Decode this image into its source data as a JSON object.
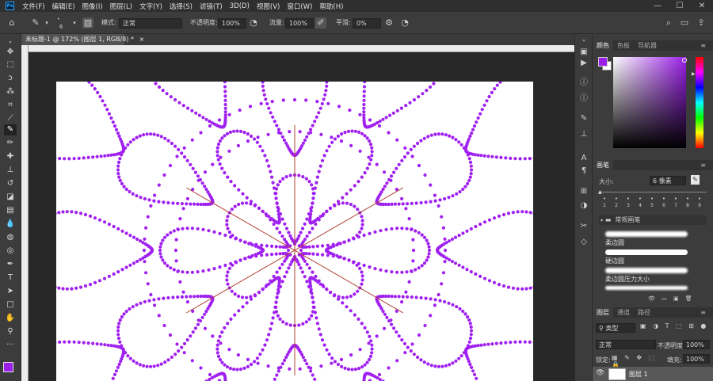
{
  "app": {
    "logo_text": "Ps"
  },
  "menu": [
    "文件(F)",
    "编辑(E)",
    "图像(I)",
    "图层(L)",
    "文字(Y)",
    "选择(S)",
    "滤镜(T)",
    "3D(D)",
    "视图(V)",
    "窗口(W)",
    "帮助(H)"
  ],
  "window_controls": {
    "minimize": "—",
    "maximize": "☐",
    "close": "✕"
  },
  "options": {
    "brush_size": "6",
    "mode_label": "模式:",
    "mode_value": "正常",
    "opacity_label": "不透明度:",
    "opacity_value": "100%",
    "flow_label": "流量:",
    "flow_value": "100%",
    "smooth_label": "平滑:",
    "smooth_value": "0%"
  },
  "document_tab": {
    "title": "未标题-1 @ 172% (图层 1, RGB/8) *",
    "close": "×"
  },
  "color_panel": {
    "tabs": [
      "颜色",
      "色板",
      "导航器"
    ],
    "foreground": "#9b1fe8",
    "background": "#ffffff"
  },
  "brush_panel": {
    "title": "画笔",
    "size_label": "大小:",
    "size_value": "6 像素",
    "presets_cells": [
      "1",
      "2",
      "3",
      "4",
      "5",
      "6",
      "7",
      "8",
      "9"
    ],
    "folder_label": "常规画笔",
    "brushes": [
      "柔边圆",
      "硬边圆",
      "柔边圆压力大小",
      ""
    ]
  },
  "layers_panel": {
    "tabs": [
      "图层",
      "通道",
      "路径"
    ],
    "filter_label": "类型",
    "blend_mode": "正常",
    "opacity_label": "不透明度:",
    "opacity_value": "100%",
    "lock_label": "锁定:",
    "fill_label": "填充:",
    "fill_value": "100%",
    "layer_name": "图层 1"
  },
  "colors": {
    "dot": "#a020f0",
    "symmetry_line": "#b04030"
  },
  "tools": [
    "move",
    "marquee",
    "lasso",
    "magic-wand",
    "crop",
    "frame",
    "eyedropper",
    "spot-heal",
    "brush",
    "clone-stamp",
    "history-brush",
    "eraser",
    "gradient",
    "blur",
    "dodge",
    "pen",
    "type",
    "path-select",
    "rectangle",
    "hand",
    "zoom",
    "more"
  ]
}
